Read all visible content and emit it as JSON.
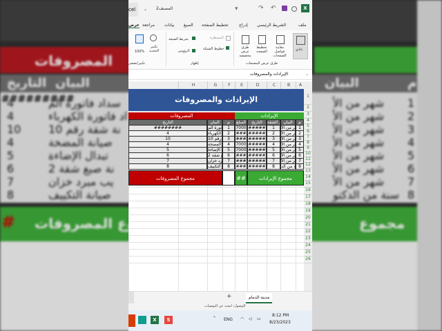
{
  "window": {
    "title": "المصنف2",
    "app_name": "Excel"
  },
  "menu": {
    "tabs": [
      "ملف",
      "الشريط الرئيسي",
      "إدراج",
      "تخطيط الصفحة",
      "الصيغ",
      "بيانات",
      "مراجعة",
      "عرض"
    ]
  },
  "ribbon": {
    "normal": "عادي",
    "page_break_preview": "معاينة فواصل الصفحات",
    "page_layout": "تخطيط الصفحة",
    "custom_views": "طرق عرض مخصصة",
    "views_group": "طرق عرض المصنفات",
    "ruler": "المسطرة",
    "formula_bar": "شريط الصيغة",
    "gridlines": "خطوط الشبكة",
    "headings": "الرؤوس",
    "show_group": "إظهار",
    "zoom": "تكبير/تصغير",
    "zoom_100": "100%",
    "zoom_selection": "تكبير التحديد",
    "zoom_group": "تكبير/تصغير"
  },
  "formula_bar": {
    "content": "الإيرادات والمصروفات"
  },
  "columns": [
    "A",
    "B",
    "C",
    "D",
    "E",
    "F",
    "G",
    "H"
  ],
  "rows": [
    "1",
    "2",
    "3",
    "4",
    "5",
    "6",
    "7",
    "8",
    "9",
    "10",
    "11",
    "12",
    "13",
    "14",
    "15",
    "16",
    "17",
    "18",
    "19",
    "20",
    "21",
    "22",
    "23",
    "24",
    "25",
    "26"
  ],
  "sheet": {
    "title": "الإيرادات والمصروفات",
    "income_header": "الإيرادات",
    "expense_header": "المصروفات",
    "income_cols": [
      "م",
      "البيان",
      "رقم الشقة",
      "التاريخ",
      "المبلغ"
    ],
    "expense_cols": [
      "م",
      "البيان",
      "التاريخ"
    ],
    "income_rows": [
      [
        "1",
        "شهر من الأ",
        "1",
        "#####",
        "7000"
      ],
      [
        "2",
        "شهر من الأ",
        "2",
        "#####",
        "###"
      ],
      [
        "3",
        "شهر من الأ",
        "3",
        "#####",
        "###"
      ],
      [
        "4",
        "شهر من الأ",
        "4",
        "#####",
        "7000"
      ],
      [
        "5",
        "شهر من الأ",
        "5",
        "#####",
        "7000"
      ],
      [
        "6",
        "شهر من الأ",
        "6",
        "#####",
        "###"
      ],
      [
        "7",
        "شهر من الأ",
        "7",
        "#####",
        "###"
      ],
      [
        "8",
        "سنة من الد",
        "8",
        "#####",
        "###"
      ]
    ],
    "expense_rows": [
      [
        "1",
        "سداد فاتورة الم",
        "########"
      ],
      [
        "2",
        "داد فاتورة الكهرباء",
        "4"
      ],
      [
        "3",
        "ناية شقة رقم 10",
        "10"
      ],
      [
        "4",
        "صيانة المضخة",
        "4"
      ],
      [
        "5",
        "ستبدال الإضاءة",
        "5"
      ],
      [
        "6",
        "ناية صبغ شقة 2",
        "6"
      ],
      [
        "7",
        "ريب مبرد خزان",
        "7"
      ],
      [
        "8",
        "صيانة التكييف",
        "8"
      ]
    ],
    "income_total_label": "مجموع الإيرادات",
    "income_total_value": "##",
    "expense_total_label": "مجموع المصروفات"
  },
  "sheet_tabs": {
    "active": "مدينة الدمام",
    "add": "+"
  },
  "statusbar": {
    "text": "الوصول: ابحث عن التوصيات"
  },
  "taskbar": {
    "lang": "ENG",
    "time": "8:12 PM",
    "date": "8/23/2023"
  },
  "background": {
    "col_m": "م",
    "col_bayan": "البيان",
    "col_date": "التاريخ",
    "expenses": "المصروفات",
    "rows_right": [
      "شهر من الأ",
      "شهر من الأ",
      "شهر من الأ",
      "شهر من الأ",
      "شهر من الأ",
      "شهر من الأ",
      "شهر من الأ",
      "سنة من الدكتو"
    ],
    "nums_right": [
      "1",
      "2",
      "3",
      "4",
      "5",
      "6",
      "7",
      "8"
    ],
    "rows_left": [
      "سداد فاتورة الم",
      "اد فاتورة الكهرباء",
      "نة شقة رقم 10",
      "صيانة المضخة",
      "تبدال الإضاءة",
      "نة صبغ شقة 2",
      "يب مبرد خزان",
      "صيانة التكييف"
    ],
    "nums_left": [
      "4",
      "4",
      "10",
      "4",
      "5",
      "6",
      "7",
      "8"
    ],
    "total_expenses": "مجموع المصروفات",
    "total_income": "مجموع",
    "hash": "#",
    "hashes": "#########"
  },
  "colors": {
    "title_blue": "#2f5597",
    "income_green": "#3aaa35",
    "expense_red": "#c00000",
    "header_gray": "#6d6d6d",
    "excel_green": "#217346"
  }
}
